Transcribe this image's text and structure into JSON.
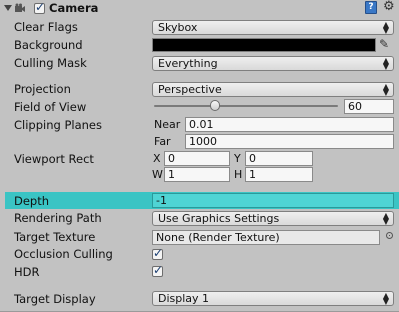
{
  "header": {
    "title": "Camera",
    "enabled": true
  },
  "fields": {
    "clear_flags": {
      "label": "Clear Flags",
      "value": "Skybox"
    },
    "background": {
      "label": "Background",
      "color": "#000000"
    },
    "culling_mask": {
      "label": "Culling Mask",
      "value": "Everything"
    },
    "projection": {
      "label": "Projection",
      "value": "Perspective"
    },
    "field_of_view": {
      "label": "Field of View",
      "value": "60",
      "slider_fraction": 0.33
    },
    "clipping_planes": {
      "label": "Clipping Planes",
      "near_label": "Near",
      "near_value": "0.01",
      "far_label": "Far",
      "far_value": "1000"
    },
    "viewport_rect": {
      "label": "Viewport Rect",
      "x_label": "X",
      "x_value": "0",
      "y_label": "Y",
      "y_value": "0",
      "w_label": "W",
      "w_value": "1",
      "h_label": "H",
      "h_value": "1"
    },
    "depth": {
      "label": "Depth",
      "value": "-1"
    },
    "rendering_path": {
      "label": "Rendering Path",
      "value": "Use Graphics Settings"
    },
    "target_texture": {
      "label": "Target Texture",
      "value": "None (Render Texture)"
    },
    "occlusion_culling": {
      "label": "Occlusion Culling",
      "checked": true
    },
    "hdr": {
      "label": "HDR",
      "checked": true
    },
    "target_display": {
      "label": "Target Display",
      "value": "Display 1"
    }
  },
  "colors": {
    "panel": "#c2c2c2",
    "highlight": "#3ac4c4"
  }
}
